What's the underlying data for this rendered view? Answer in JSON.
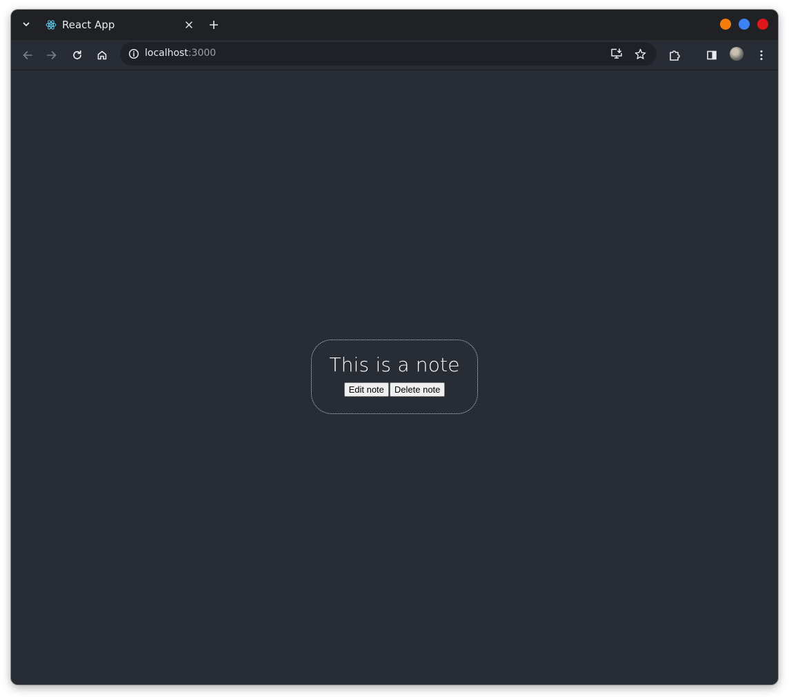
{
  "tab": {
    "title": "React App",
    "favicon": "react-icon"
  },
  "omnibox": {
    "host": "localhost",
    "port": ":3000"
  },
  "note": {
    "text": "This is a note",
    "edit_label": "Edit note",
    "delete_label": "Delete note"
  },
  "window_controls": {
    "minimize_color": "#f57c0a",
    "maximize_color": "#3b82f6",
    "close_color": "#e0161a"
  },
  "colors": {
    "page_bg": "#282c34",
    "chrome_bg": "#202124",
    "react_accent": "#61dafb"
  }
}
